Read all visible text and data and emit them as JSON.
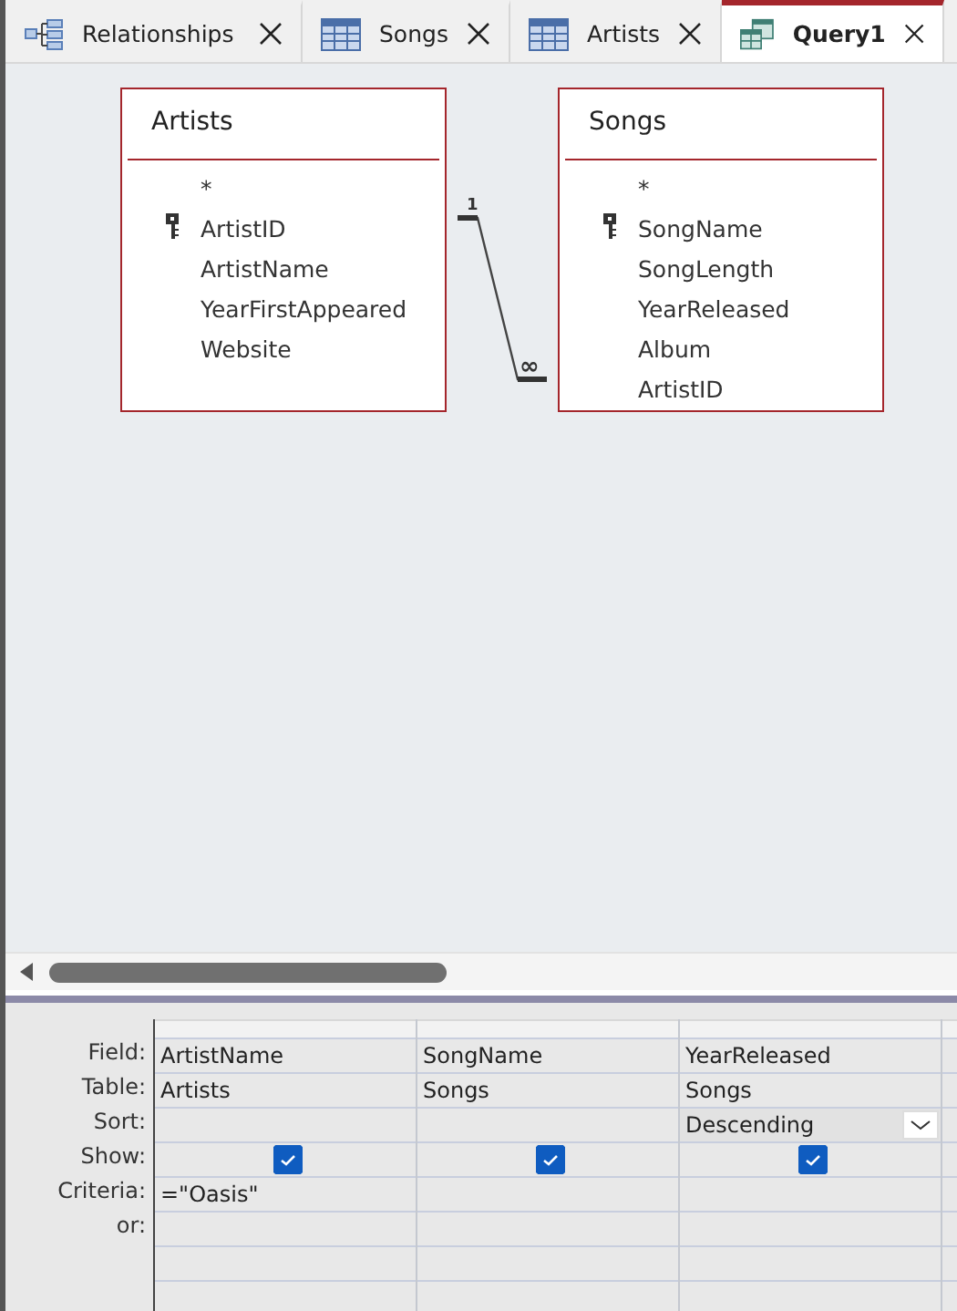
{
  "tabs": [
    {
      "label": "Relationships",
      "kind": "relationships",
      "selected": false
    },
    {
      "label": "Songs",
      "kind": "table",
      "selected": false
    },
    {
      "label": "Artists",
      "kind": "table",
      "selected": false
    },
    {
      "label": "Query1",
      "kind": "query",
      "selected": true
    }
  ],
  "design_tables": [
    {
      "name": "Artists",
      "fields": [
        {
          "name": "*",
          "key": false
        },
        {
          "name": "ArtistID",
          "key": true
        },
        {
          "name": "ArtistName",
          "key": false
        },
        {
          "name": "YearFirstAppeared",
          "key": false
        },
        {
          "name": "Website",
          "key": false
        }
      ]
    },
    {
      "name": "Songs",
      "fields": [
        {
          "name": "*",
          "key": false
        },
        {
          "name": "SongName",
          "key": true
        },
        {
          "name": "SongLength",
          "key": false
        },
        {
          "name": "YearReleased",
          "key": false
        },
        {
          "name": "Album",
          "key": false
        },
        {
          "name": "ArtistID",
          "key": false
        }
      ]
    }
  ],
  "relationship": {
    "one_label": "1",
    "many_label": "∞"
  },
  "grid": {
    "row_labels": [
      "Field:",
      "Table:",
      "Sort:",
      "Show:",
      "Criteria:",
      "or:"
    ],
    "columns": [
      {
        "field": "ArtistName",
        "table": "Artists",
        "show": true,
        "criteria": "=\"Oasis\"",
        "active": false
      },
      {
        "field": "SongName",
        "table": "Songs",
        "show": true,
        "active": false
      },
      {
        "field": "YearReleased",
        "table": "Songs",
        "sort": "Descending",
        "show": true,
        "active": true
      }
    ]
  }
}
